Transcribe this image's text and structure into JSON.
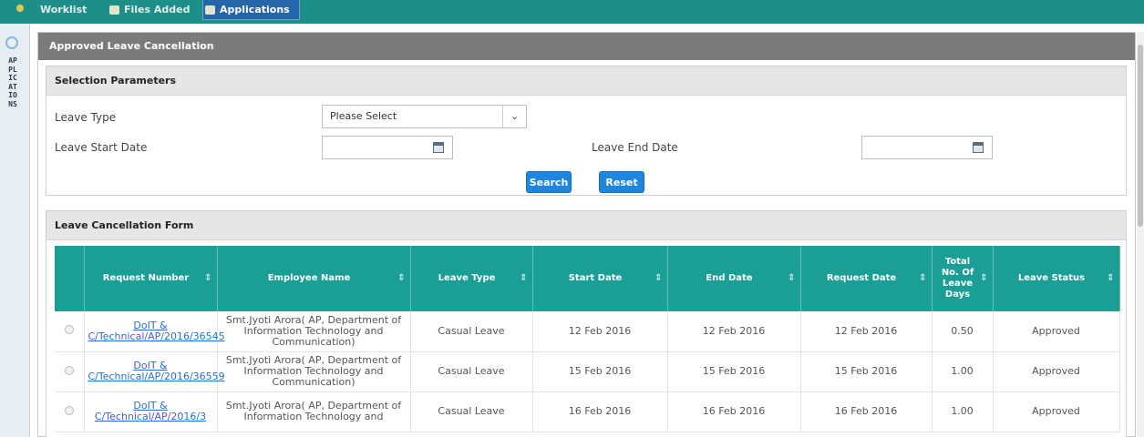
{
  "nav": {
    "tabs": [
      {
        "label": "Worklist",
        "icon": "worklist-icon"
      },
      {
        "label": "Files Added",
        "icon": "files-icon"
      },
      {
        "label": "Applications",
        "icon": "applications-icon"
      }
    ]
  },
  "sidebar": {
    "vertical_label": "APPLICATIONS"
  },
  "panel": {
    "title": "Approved Leave Cancellation"
  },
  "selection": {
    "title": "Selection Parameters",
    "leave_type_label": "Leave Type",
    "leave_type_value": "Please Select",
    "leave_start_label": "Leave Start Date",
    "leave_end_label": "Leave End Date",
    "search_label": "Search",
    "reset_label": "Reset"
  },
  "form": {
    "title": "Leave Cancellation Form",
    "columns": [
      "Request Number",
      "Employee Name",
      "Leave Type",
      "Start Date",
      "End Date",
      "Request Date",
      "Total No. Of Leave Days",
      "Leave Status"
    ],
    "rows": [
      {
        "request": "DoIT & C/Technical/AP/2016/36545",
        "employee": "Smt.Jyoti Arora( AP, Department of Information Technology and Communication)",
        "leave_type": "Casual Leave",
        "start": "12 Feb 2016",
        "end": "12 Feb 2016",
        "request_date": "12 Feb 2016",
        "days": "0.50",
        "status": "Approved"
      },
      {
        "request": "DoIT & C/Technical/AP/2016/36559",
        "employee": "Smt.Jyoti Arora( AP, Department of Information Technology and Communication)",
        "leave_type": "Casual Leave",
        "start": "15 Feb 2016",
        "end": "15 Feb 2016",
        "request_date": "15 Feb 2016",
        "days": "1.00",
        "status": "Approved"
      },
      {
        "request": "DoIT & C/Technical/AP/2016/3",
        "employee": "Smt.Jyoti Arora( AP, Department of Information Technology and",
        "leave_type": "Casual Leave",
        "start": "16 Feb 2016",
        "end": "16 Feb 2016",
        "request_date": "16 Feb 2016",
        "days": "1.00",
        "status": "Approved"
      }
    ]
  },
  "colors": {
    "nav": "#1e8e88",
    "header": "#1b9e96",
    "button": "#1f86e0",
    "panel_header": "#7b7b7b"
  }
}
